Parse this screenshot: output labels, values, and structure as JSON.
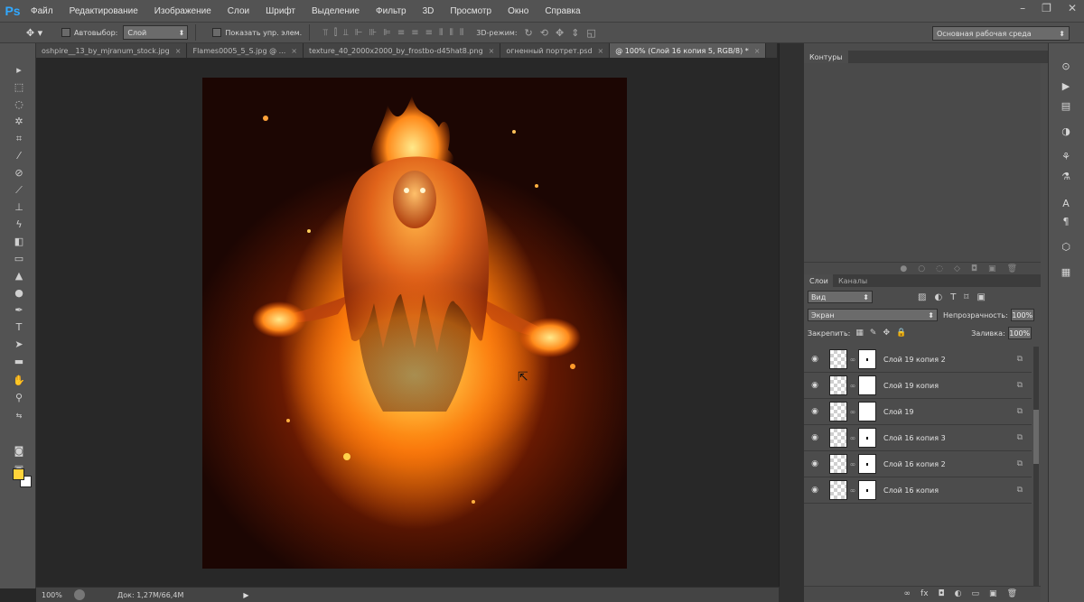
{
  "app": {
    "logo": "Ps"
  },
  "menu": [
    "Файл",
    "Редактирование",
    "Изображение",
    "Слои",
    "Шрифт",
    "Выделение",
    "Фильтр",
    "3D",
    "Просмотр",
    "Окно",
    "Справка"
  ],
  "window_controls": [
    "–",
    "❐",
    "✕"
  ],
  "options_bar": {
    "auto_select_label": "Автовыбор:",
    "auto_select_value": "Слой",
    "show_transform_label": "Показать упр. элем.",
    "mode3d_label": "3D-режим:",
    "workspace": "Основная рабочая среда"
  },
  "tabs": [
    {
      "label": "oshpire__13_by_mjranum_stock.jpg"
    },
    {
      "label": "Flames0005_5_S.jpg @ ..."
    },
    {
      "label": "texture_40_2000x2000_by_frostbo-d45hat8.png"
    },
    {
      "label": "огненный портрет.psd"
    },
    {
      "label": "@ 100% (Слой 16 копия 5, RGB/8) *"
    }
  ],
  "panels": {
    "paths_tab": "Контуры",
    "layers_tab": "Слои",
    "channels_tab": "Каналы",
    "kind_filter": "Вид",
    "blend_mode": "Экран",
    "opacity_label": "Непрозрачность:",
    "opacity_value": "100%",
    "lock_label": "Закрепить:",
    "fill_label": "Заливка:",
    "fill_value": "100%"
  },
  "layers": [
    {
      "name": "Слой 19 копия 2"
    },
    {
      "name": "Слой 19 копия"
    },
    {
      "name": "Слой 19"
    },
    {
      "name": "Слой 16 копия 3"
    },
    {
      "name": "Слой 16 копия 2"
    },
    {
      "name": "Слой 16 копия"
    }
  ],
  "status": {
    "zoom": "100%",
    "doc_info": "Док: 1,27M/66,4M"
  },
  "colors": {
    "foreground": "#ffd33a",
    "background": "#ffffff",
    "ps_blue": "#31a8ff"
  }
}
